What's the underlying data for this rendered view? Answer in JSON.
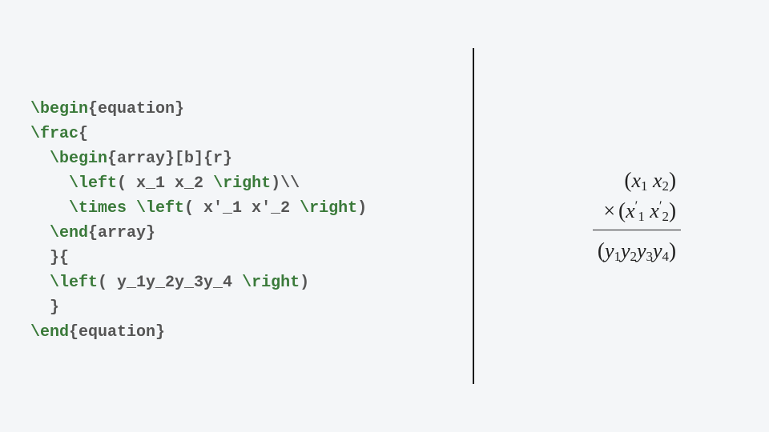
{
  "code": {
    "l1": {
      "cmd": "\\begin",
      "arg": "{equation}"
    },
    "l2": {
      "cmd": "\\frac",
      "arg": "{"
    },
    "l3": {
      "cmd": "\\begin",
      "arg": "{array}[b]{r}"
    },
    "l4": {
      "cmd": "\\left",
      "mid": "( x_1 x_2 ",
      "cmd2": "\\right",
      "tail": ")\\\\"
    },
    "l5": {
      "cmd": "\\times \\left",
      "mid": "( x'_1 x'_2 ",
      "cmd2": "\\right",
      "tail": ")"
    },
    "l6": {
      "cmd": "\\end",
      "arg": "{array}"
    },
    "l7": "}{",
    "l8": {
      "cmd": "\\left",
      "mid": "( y_1y_2y_3y_4 ",
      "cmd2": "\\right",
      "tail": ")"
    },
    "l9": "}",
    "l10": {
      "cmd": "\\end",
      "arg": "{equation}"
    }
  },
  "math": {
    "num_row1": {
      "open": "(",
      "x1": "x",
      "s1": "1",
      "sp": " ",
      "x2": "x",
      "s2": "2",
      "close": ")"
    },
    "num_row2": {
      "times": "×",
      "open": "(",
      "x1": "x",
      "p1": "′",
      "s1": "1",
      "sp": " ",
      "x2": "x",
      "p2": "′",
      "s2": "2",
      "close": ")"
    },
    "den": {
      "open": "(",
      "y1": "y",
      "s1": "1",
      "y2": "y",
      "s2": "2",
      "y3": "y",
      "s3": "3",
      "y4": "y",
      "s4": "4",
      "close": ")"
    }
  }
}
